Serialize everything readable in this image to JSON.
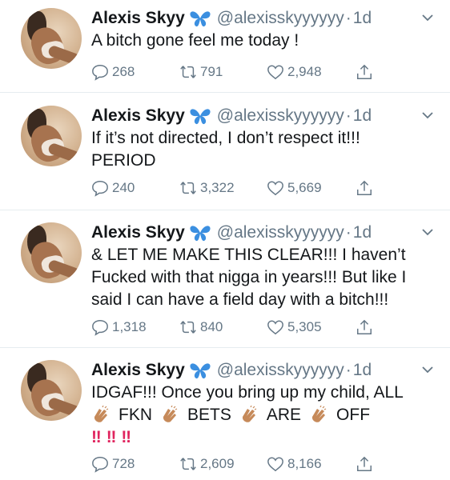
{
  "colors": {
    "text": "#14171a",
    "muted": "#657786",
    "divider": "#e6ecf0",
    "verified_butterfly": "#3b8fe0",
    "exclaim": "#e0245e",
    "clap": "#c68a5a"
  },
  "tweets": [
    {
      "author": {
        "name": "Alexis Skyy",
        "handle": "@alexisskyyyyyy",
        "separator": "·",
        "time": "1d"
      },
      "lines": [
        "A bitch gone feel me today !"
      ],
      "stats": {
        "replies": "268",
        "retweets": "791",
        "likes": "2,948"
      }
    },
    {
      "author": {
        "name": "Alexis Skyy",
        "handle": "@alexisskyyyyyy",
        "separator": "·",
        "time": "1d"
      },
      "lines": [
        "If it’s not directed, I don’t respect it!!!",
        "PERIOD"
      ],
      "stats": {
        "replies": "240",
        "retweets": "3,322",
        "likes": "5,669"
      }
    },
    {
      "author": {
        "name": "Alexis Skyy",
        "handle": "@alexisskyyyyyy",
        "separator": "·",
        "time": "1d"
      },
      "lines": [
        "& LET ME MAKE THIS CLEAR!!! I haven’t",
        "Fucked with that nigga in years!!! But like I",
        "said I can have a field day with a bitch!!!"
      ],
      "stats": {
        "replies": "1,318",
        "retweets": "840",
        "likes": "5,305"
      }
    },
    {
      "author": {
        "name": "Alexis Skyy",
        "handle": "@alexisskyyyyyy",
        "separator": "·",
        "time": "1d"
      },
      "lines": [
        "IDGAF!!! Once you bring up my child, ALL"
      ],
      "clap_words": [
        "FKN",
        "BETS",
        "ARE",
        "OFF"
      ],
      "exclaims": [
        "‼",
        "‼",
        "‼"
      ],
      "stats": {
        "replies": "728",
        "retweets": "2,609",
        "likes": "8,166"
      }
    }
  ],
  "icons": [
    "avatar",
    "verified-butterfly-icon",
    "chevron-down-icon",
    "reply-icon",
    "retweet-icon",
    "like-icon",
    "share-icon",
    "clapping-hands-icon"
  ]
}
